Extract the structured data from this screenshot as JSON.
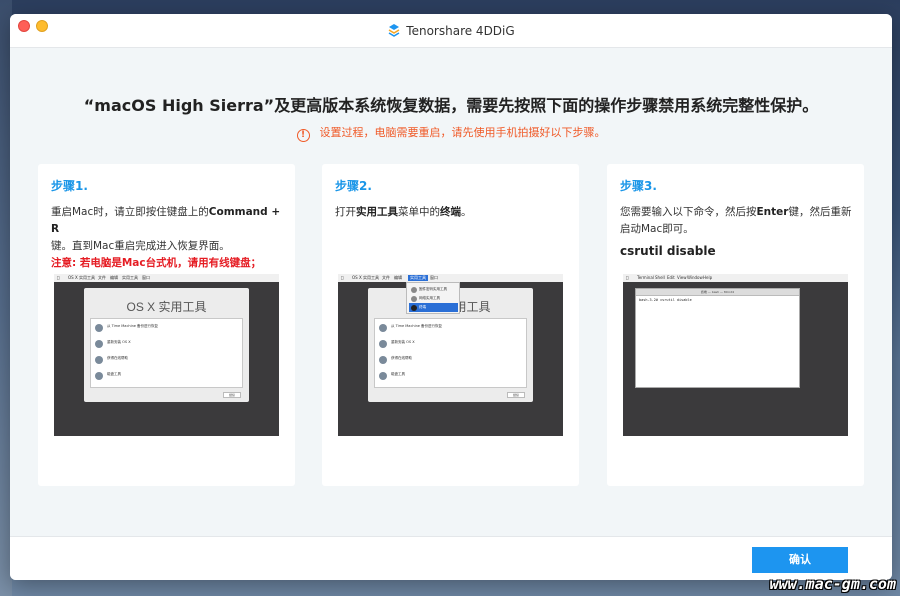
{
  "window": {
    "app_title": "Tenorshare 4DDiG"
  },
  "main": {
    "heading": "“macOS High Sierra”及更高版本系统恢复数据，需要先按照下面的操作步骤禁用系统完整性保护。",
    "warning": "设置过程，电脑需要重启，请先使用手机拍摄好以下步骤。"
  },
  "steps": [
    {
      "title": "步骤1.",
      "text_a": "重启Mac时，请立即按住键盘上的",
      "text_bold": "Command + R",
      "text_b": "键。直到Mac重启完成进入恢复界面。",
      "note": "注意: 若电脑是Mac台式机，请用有线键盘；",
      "image": {
        "menubar": [
          "OS X 实用工具",
          "文件",
          "编辑",
          "实用工具",
          "窗口"
        ],
        "dialog_title": "OS X 实用工具",
        "items": [
          "从 Time Machine 备份进行恢复",
          "重新安装 OS X",
          "获得在线帮助",
          "磁盘工具"
        ],
        "button": "继续"
      }
    },
    {
      "title": "步骤2.",
      "text_a": "打开",
      "text_bold": "实用工具",
      "text_b": "菜单中的",
      "text_bold2": "终端",
      "text_c": "。",
      "image": {
        "menubar": [
          "OS X 实用工具",
          "文件",
          "编辑",
          "实用工具",
          "窗口"
        ],
        "menu_items": [
          "固件密码实用工具",
          "网络实用工具",
          "终端"
        ],
        "dialog_title": "OS X 实用工具",
        "items": [
          "从 Time Machine 备份进行恢复",
          "重新安装 OS X",
          "获得在线帮助",
          "磁盘工具"
        ],
        "button": "继续"
      }
    },
    {
      "title": "步骤3.",
      "text_a": "您需要输入以下命令，然后按",
      "text_bold": "Enter",
      "text_b": "键，然后重新启动Mac即可。",
      "command": "csrutil disable",
      "image": {
        "menubar": [
          "Terminal",
          "Shell",
          "Edit",
          "View",
          "Window",
          "Help"
        ],
        "terminal_title": "终端 — bash — 80×24",
        "terminal_line": "bash-3.2# csrutil disable"
      }
    }
  ],
  "footer": {
    "ok_label": "确认"
  },
  "watermark": "www.mac-gm.com",
  "colors": {
    "accent": "#1d95f0",
    "warning": "#f05a28",
    "note": "#e51c23"
  }
}
